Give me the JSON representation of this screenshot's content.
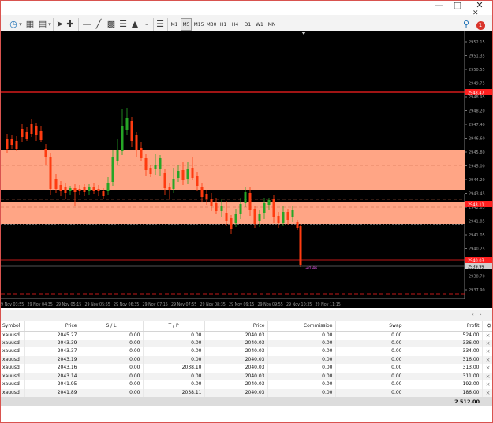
{
  "timeframes": [
    "M1",
    "M5",
    "M15",
    "M30",
    "H1",
    "H4",
    "D1",
    "W1",
    "MN"
  ],
  "active_timeframe": "M5",
  "notification_count": "1",
  "price_axis": {
    "labels": [
      "2952.15",
      "2951.35",
      "2950.55",
      "2949.75",
      "2948.95",
      "2948.20",
      "2947.40",
      "2946.60",
      "2945.80",
      "2945.00",
      "2944.20",
      "2943.45",
      "2942.65",
      "2941.85",
      "2941.05",
      "2940.25",
      "2939.50",
      "2938.70",
      "2937.90"
    ]
  },
  "time_axis": {
    "labels": [
      "29 Nov 03:55",
      "29 Nov 04:35",
      "29 Nov 05:15",
      "29 Nov 05:55",
      "29 Nov 06:35",
      "29 Nov 07:15",
      "29 Nov 07:55",
      "29 Nov 08:35",
      "29 Nov 09:15",
      "29 Nov 09:55",
      "29 Nov 10:35",
      "29 Nov 11:15"
    ]
  },
  "chart_lines": {
    "top_red_line_label": "2948.47",
    "bid_label": "2943.11",
    "current_label": "2940.03",
    "ask_label": "2939.99",
    "pip_readout": "+0.46"
  },
  "colors": {
    "bull_candle": "#26a626",
    "bear_candle": "#ff3b10",
    "zone": "#ffa585",
    "line_red": "#ff2020",
    "background": "#000000"
  },
  "positions": {
    "columns": [
      "Symbol",
      "Price",
      "S / L",
      "T / P",
      "Price",
      "Commission",
      "Swap",
      "Profit"
    ],
    "rows": [
      {
        "symbol": "xauusd",
        "price": "2045.27",
        "sl": "0.00",
        "tp": "0.00",
        "cur": "2040.03",
        "commission": "0.00",
        "swap": "0.00",
        "profit": "524.00"
      },
      {
        "symbol": "xauusd",
        "price": "2043.39",
        "sl": "0.00",
        "tp": "0.00",
        "cur": "2040.03",
        "commission": "0.00",
        "swap": "0.00",
        "profit": "336.00"
      },
      {
        "symbol": "xauusd",
        "price": "2043.37",
        "sl": "0.00",
        "tp": "0.00",
        "cur": "2040.03",
        "commission": "0.00",
        "swap": "0.00",
        "profit": "334.00"
      },
      {
        "symbol": "xauusd",
        "price": "2043.19",
        "sl": "0.00",
        "tp": "0.00",
        "cur": "2040.03",
        "commission": "0.00",
        "swap": "0.00",
        "profit": "316.00"
      },
      {
        "symbol": "xauusd",
        "price": "2043.16",
        "sl": "0.00",
        "tp": "2038.10",
        "cur": "2040.03",
        "commission": "0.00",
        "swap": "0.00",
        "profit": "313.00"
      },
      {
        "symbol": "xauusd",
        "price": "2043.14",
        "sl": "0.00",
        "tp": "0.00",
        "cur": "2040.03",
        "commission": "0.00",
        "swap": "0.00",
        "profit": "311.00"
      },
      {
        "symbol": "xauusd",
        "price": "2041.95",
        "sl": "0.00",
        "tp": "0.00",
        "cur": "2040.03",
        "commission": "0.00",
        "swap": "0.00",
        "profit": "192.00"
      },
      {
        "symbol": "xauusd",
        "price": "2041.89",
        "sl": "0.00",
        "tp": "2038.11",
        "cur": "2040.03",
        "commission": "0.00",
        "swap": "0.00",
        "profit": "186.00"
      }
    ],
    "total_profit": "2 512.00"
  }
}
